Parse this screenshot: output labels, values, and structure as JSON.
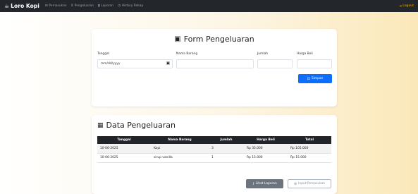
{
  "navbar": {
    "brand": "Loro Kopi",
    "links": [
      {
        "label": "Pemasukan",
        "icon": "inbox-icon"
      },
      {
        "label": "Pengeluaran",
        "icon": "cart-icon"
      },
      {
        "label": "Laporan",
        "icon": "bar-chart-icon"
      },
      {
        "label": "History Rekap",
        "icon": "clock-icon"
      }
    ],
    "logout": "Logout"
  },
  "form": {
    "title": "Form Pengeluaran",
    "labels": {
      "tanggal": "Tanggal",
      "nama_barang": "Nama Barang",
      "jumlah": "Jumlah",
      "harga_beli": "Harga Beli"
    },
    "date_placeholder": "mm/dd/yyyy",
    "save_label": "Simpan"
  },
  "data": {
    "title": "Data Pengeluaran",
    "columns": [
      "Tanggal",
      "Nama Barang",
      "Jumlah",
      "Harga Beli",
      "Total"
    ],
    "rows": [
      [
        "10-06-2025",
        "Kopi",
        "3",
        "Rp 35.000",
        "Rp 105.000"
      ],
      [
        "10-06-2025",
        "sirup vanilla",
        "1",
        "Rp 15.000",
        "Rp 15.000"
      ]
    ],
    "report_label": "Lihat Laporan",
    "input_label": "Input Pemasukan"
  },
  "colors": {
    "navbar": "#23272b",
    "primary": "#0d6efd",
    "secondary": "#6c757d",
    "logout": "#f0b400"
  }
}
